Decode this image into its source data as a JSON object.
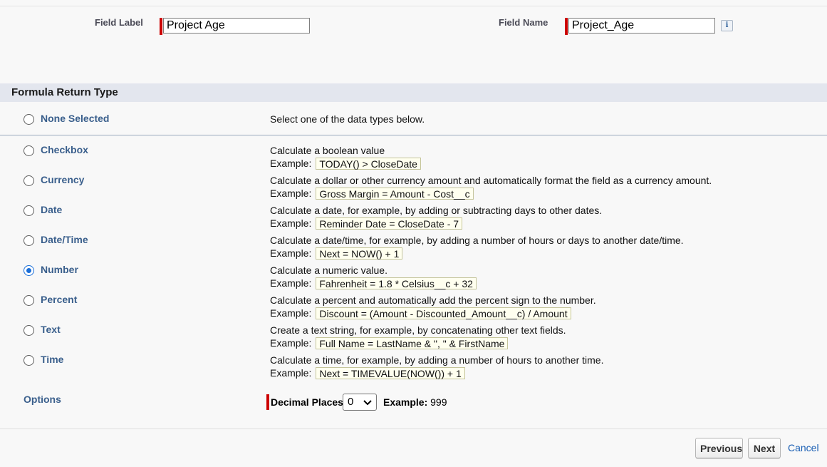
{
  "fields": {
    "field_label": {
      "label": "Field Label",
      "value": "Project Age"
    },
    "field_name": {
      "label": "Field Name",
      "value": "Project_Age"
    }
  },
  "section": {
    "title": "Formula Return Type"
  },
  "none_option": {
    "label": "None Selected",
    "description": "Select one of the data types below."
  },
  "example_prefix": "Example:",
  "types": [
    {
      "label": "Checkbox",
      "description": "Calculate a boolean value",
      "example": "TODAY() > CloseDate",
      "selected": false
    },
    {
      "label": "Currency",
      "description": "Calculate a dollar or other currency amount and automatically format the field as a currency amount.",
      "example": "Gross Margin = Amount - Cost__c",
      "selected": false
    },
    {
      "label": "Date",
      "description": "Calculate a date, for example, by adding or subtracting days to other dates.",
      "example": "Reminder Date = CloseDate - 7",
      "selected": false
    },
    {
      "label": "Date/Time",
      "description": "Calculate a date/time, for example, by adding a number of hours or days to another date/time.",
      "example": "Next = NOW() + 1",
      "selected": false
    },
    {
      "label": "Number",
      "description": "Calculate a numeric value.",
      "example": "Fahrenheit = 1.8 * Celsius__c + 32",
      "selected": true
    },
    {
      "label": "Percent",
      "description": "Calculate a percent and automatically add the percent sign to the number.",
      "example": "Discount = (Amount - Discounted_Amount__c) / Amount",
      "selected": false
    },
    {
      "label": "Text",
      "description": "Create a text string, for example, by concatenating other text fields.",
      "example": "Full Name = LastName & \", \" & FirstName",
      "selected": false
    },
    {
      "label": "Time",
      "description": "Calculate a time, for example, by adding a number of hours to another time.",
      "example": "Next = TIMEVALUE(NOW()) + 1",
      "selected": false
    }
  ],
  "options": {
    "label": "Options",
    "decimal_places_label": "Decimal Places",
    "decimal_places_value": "0",
    "example_label": "Example:",
    "example_value": "999"
  },
  "buttons": {
    "previous": "Previous",
    "next": "Next",
    "cancel": "Cancel"
  },
  "colors": {
    "required": "#cc0000",
    "link": "#1a5fb4",
    "label": "#3a5f8c",
    "selected_radio": "#1a6ed8"
  }
}
